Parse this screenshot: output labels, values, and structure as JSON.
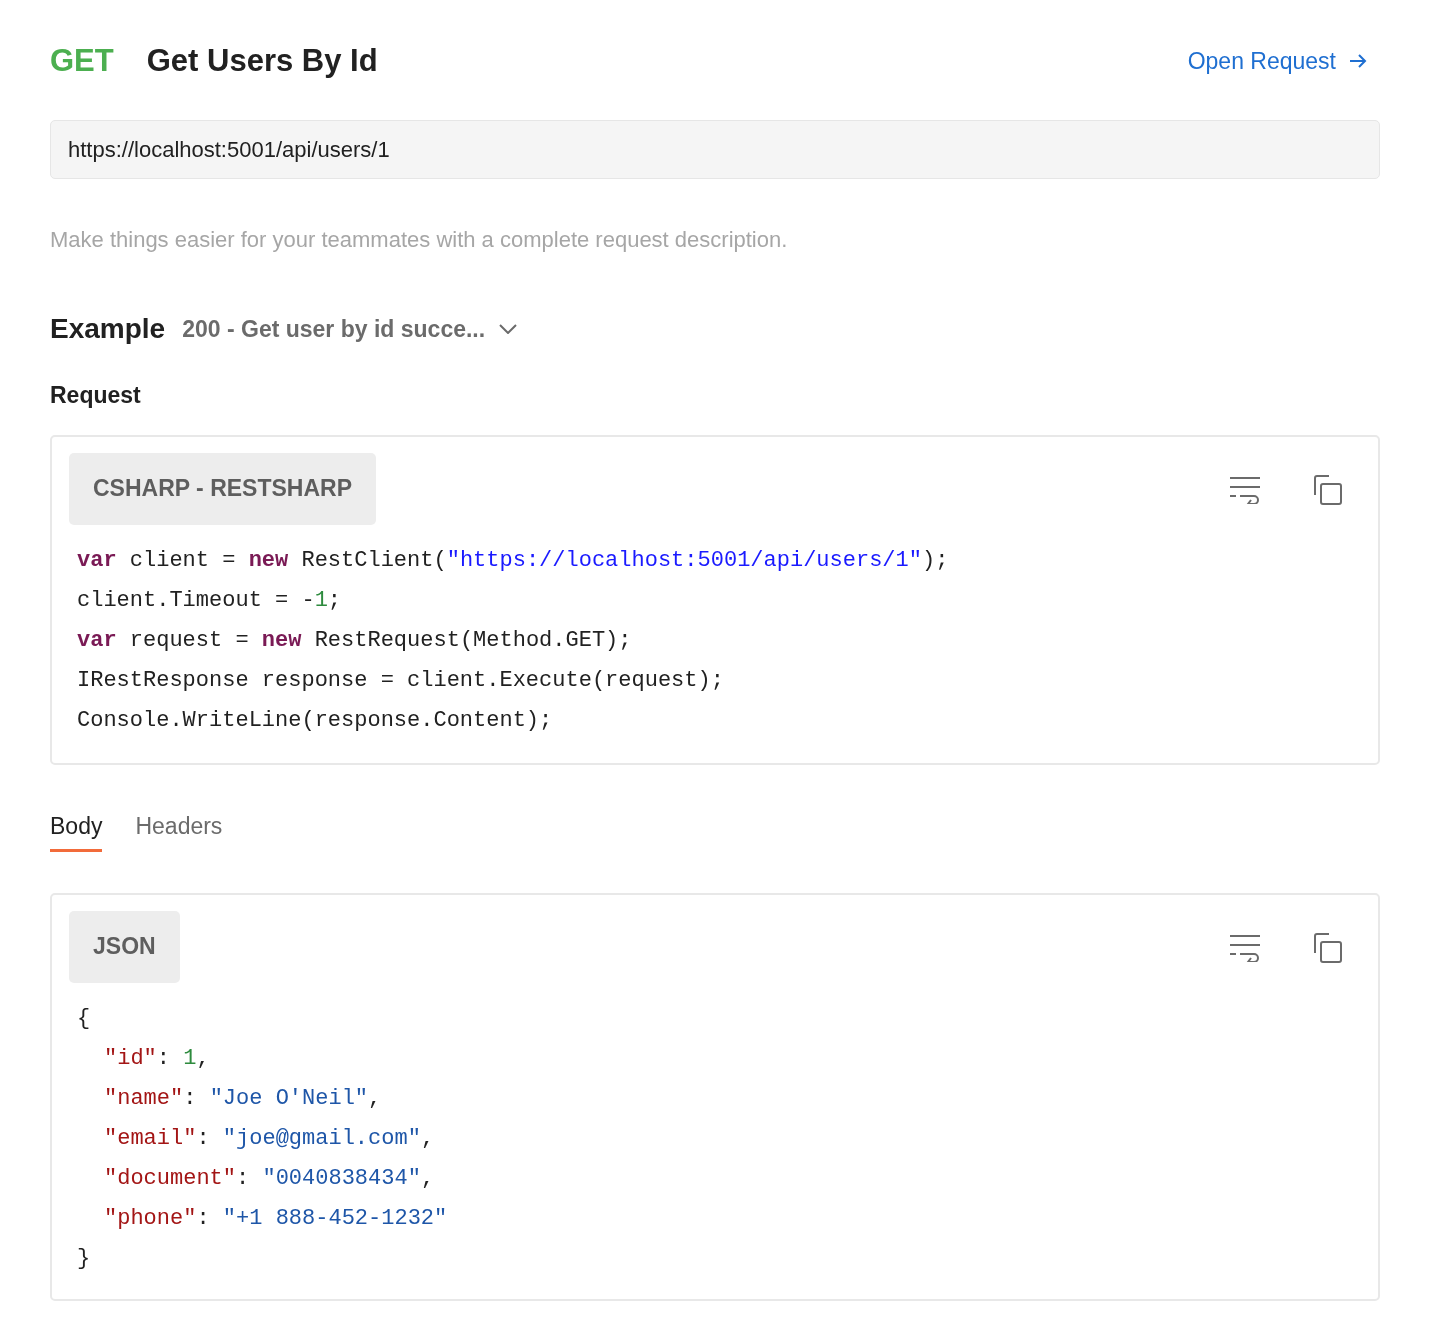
{
  "header": {
    "method": "GET",
    "title": "Get Users By Id",
    "open_link": "Open Request"
  },
  "url": {
    "value": "https://localhost:5001/api/users/1"
  },
  "description": {
    "placeholder": "Make things easier for your teammates with a complete request description."
  },
  "example": {
    "label": "Example",
    "selected_example": "200 - Get user by id succe..."
  },
  "request": {
    "label": "Request",
    "language": "CSHARP - RESTSHARP",
    "lines": [
      [
        {
          "kind": "keyword",
          "text": "var"
        },
        {
          "kind": "plain",
          "text": " client = "
        },
        {
          "kind": "keyword",
          "text": "new"
        },
        {
          "kind": "plain",
          "text": " RestClient("
        },
        {
          "kind": "url",
          "text": "\"https://localhost:5001/api/users/1\""
        },
        {
          "kind": "plain",
          "text": ");"
        }
      ],
      [
        {
          "kind": "plain",
          "text": "client.Timeout = -"
        },
        {
          "kind": "number",
          "text": "1"
        },
        {
          "kind": "plain",
          "text": ";"
        }
      ],
      [
        {
          "kind": "keyword",
          "text": "var"
        },
        {
          "kind": "plain",
          "text": " request = "
        },
        {
          "kind": "keyword",
          "text": "new"
        },
        {
          "kind": "plain",
          "text": " RestRequest(Method.GET);"
        }
      ],
      [
        {
          "kind": "plain",
          "text": "IRestResponse response = client.Execute(request);"
        }
      ],
      [
        {
          "kind": "plain",
          "text": "Console.WriteLine(response.Content);"
        }
      ]
    ]
  },
  "tabs": [
    {
      "label": "Body",
      "selected": true
    },
    {
      "label": "Headers",
      "selected": false
    }
  ],
  "body": {
    "language": "JSON",
    "lines": [
      {
        "tokens": [
          {
            "kind": "plain",
            "text": "{"
          }
        ],
        "children": [
          {
            "tokens": [
              {
                "kind": "key",
                "text": "\"id\""
              },
              {
                "kind": "plain",
                "text": ": "
              },
              {
                "kind": "number",
                "text": "1"
              },
              {
                "kind": "plain",
                "text": ","
              }
            ]
          },
          {
            "tokens": [
              {
                "kind": "key",
                "text": "\"name\""
              },
              {
                "kind": "plain",
                "text": ": "
              },
              {
                "kind": "string",
                "text": "\"Joe O'Neil\""
              },
              {
                "kind": "plain",
                "text": ","
              }
            ]
          },
          {
            "tokens": [
              {
                "kind": "key",
                "text": "\"email\""
              },
              {
                "kind": "plain",
                "text": ": "
              },
              {
                "kind": "string",
                "text": "\"joe@gmail.com\""
              },
              {
                "kind": "plain",
                "text": ","
              }
            ]
          },
          {
            "tokens": [
              {
                "kind": "key",
                "text": "\"document\""
              },
              {
                "kind": "plain",
                "text": ": "
              },
              {
                "kind": "string",
                "text": "\"0040838434\""
              },
              {
                "kind": "plain",
                "text": ","
              }
            ]
          },
          {
            "tokens": [
              {
                "kind": "key",
                "text": "\"phone\""
              },
              {
                "kind": "plain",
                "text": ": "
              },
              {
                "kind": "string",
                "text": "\"+1 888-452-1232\""
              }
            ]
          }
        ]
      },
      {
        "tokens": [
          {
            "kind": "plain",
            "text": "}"
          }
        ]
      }
    ]
  }
}
